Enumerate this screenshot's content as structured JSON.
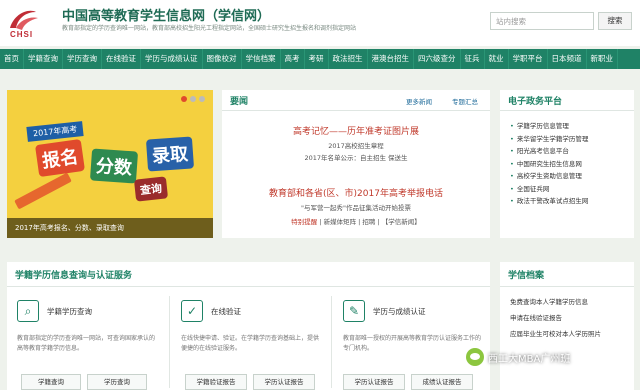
{
  "header": {
    "logo_text": "CHSI",
    "site_title": "中国高等教育学生信息网（学信网）",
    "tagline": "教育部指定的学历查询唯一网站，教育部高校招生阳光工程指定网站，全国硕士研究生招生报名和调剂指定网站",
    "search_placeholder": "站内搜索",
    "search_button": "搜索"
  },
  "nav": [
    "首页",
    "学籍查询",
    "学历查询",
    "在线验证",
    "学历与成绩认证",
    "图像校对",
    "学信档案",
    "高考",
    "考研",
    "政法招生",
    "港澳台招生",
    "四六级查分",
    "征兵",
    "就业",
    "学职平台",
    "日本频道",
    "新职业"
  ],
  "banner": {
    "tag": "2017年高考",
    "words": [
      "报名",
      "分数",
      "录取",
      "查询"
    ],
    "caption": "2017年高考报名、分数、录取查询"
  },
  "news": {
    "title": "要闻",
    "more": "更多新闻",
    "special": "专题汇总",
    "headline1": "高考记忆——历年准考证图片展",
    "sub1a": "2017高校招生章程",
    "sub1b": "2017年名单公示：自主招生 保送生",
    "headline2": "教育部和各省(区、市)2017年高考举报电话",
    "sub2": "\"与军营一起秀\"作品征集活动开始投票",
    "sub3a": "特别提醒",
    "sub3b": "| 新媒体矩阵 | 招聘 | 【学信新闻】"
  },
  "gov": {
    "title": "电子政务平台",
    "items": [
      "学籍学历信息管理",
      "来华留学生学籍学历管理",
      "阳光高考信息平台",
      "中国研究生招生信息网",
      "高校学生资助信息管理",
      "全国征兵网",
      "政法干警改革试点招生网"
    ]
  },
  "verify": {
    "title": "学籍学历信息查询与认证服务",
    "cards": [
      {
        "title": "学籍学历查询",
        "icon": "⌕",
        "desc": "教育部指定的学历查询唯一网站，可查询国家承认的高等教育学籍学历信息。",
        "buttons": [
          "学籍查询",
          "学历查询"
        ]
      },
      {
        "title": "在线验证",
        "icon": "✓",
        "desc": "在线快捷申请、验证。在学籍学历查询基础上，提供便捷的在线验证服务。",
        "buttons": [
          "学籍验证报告",
          "学历认证报告"
        ]
      },
      {
        "title": "学历与成绩认证",
        "icon": "✎",
        "desc": "教育部唯一授权的开展高等教育学历认证服务工作的专门机构。",
        "buttons": [
          "学历认证报告",
          "成绩认证报告"
        ]
      }
    ]
  },
  "archive": {
    "title": "学信档案",
    "links": [
      "免费查询本人学籍学历信息",
      "申请在线验证报告",
      "应届毕业生可校对本人学历照片"
    ]
  },
  "watermark": "西工大MBA广州班"
}
